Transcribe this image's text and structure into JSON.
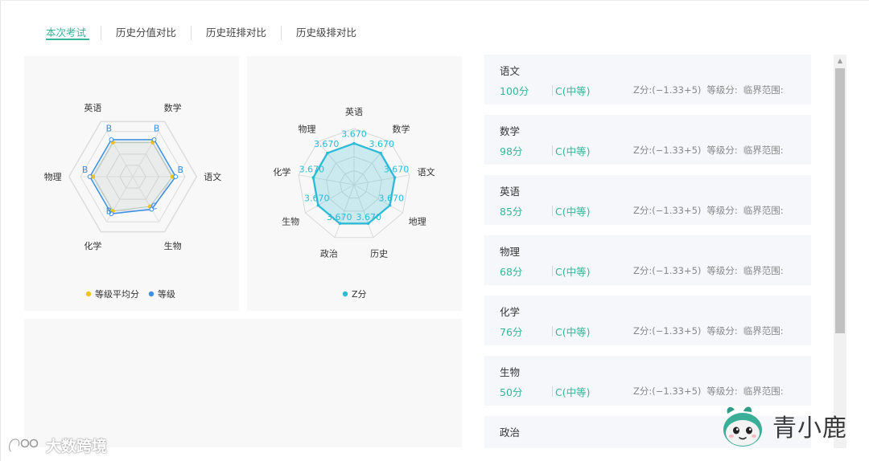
{
  "tabs": [
    {
      "label": "本次考试",
      "active": true
    },
    {
      "label": "历史分值对比",
      "active": false
    },
    {
      "label": "历史班排对比",
      "active": false
    },
    {
      "label": "历史级排对比",
      "active": false
    }
  ],
  "colors": {
    "accent": "#36b59b",
    "grade_series": "#3f8fe0",
    "avg_series": "#f5c11d",
    "z_series": "#29bcd8"
  },
  "chart_data": [
    {
      "type": "radar",
      "axes": [
        "数学",
        "语文",
        "生物",
        "化学",
        "物理",
        "英语"
      ],
      "series": [
        {
          "name": "等级平均分",
          "values": [
            "B",
            "B",
            "C",
            "B",
            "B",
            "B"
          ]
        },
        {
          "name": "等级",
          "values": [
            "B",
            "B",
            "C",
            "B",
            "B",
            "B"
          ]
        }
      ],
      "point_labels": [
        "B",
        "B",
        "C",
        "B",
        "B",
        "B"
      ],
      "legend": [
        "等级平均分",
        "等级"
      ],
      "legend_position": "bottom"
    },
    {
      "type": "radar",
      "axes": [
        "英语",
        "数学",
        "语文",
        "地理",
        "历史",
        "政治",
        "生物",
        "化学",
        "物理"
      ],
      "series": [
        {
          "name": "Z分",
          "values": [
            3.67,
            3.67,
            3.67,
            3.67,
            3.67,
            3.67,
            3.67,
            3.67,
            3.67
          ]
        }
      ],
      "point_labels": [
        "3.670",
        "3.670",
        "3.670",
        "3.670",
        "3.670",
        "3.670",
        "3.670",
        "3.670",
        "3.670"
      ],
      "legend": [
        "Z分"
      ],
      "legend_position": "bottom"
    }
  ],
  "subjects": [
    {
      "name": "语文",
      "score": "100分",
      "level": "C(中等)",
      "z": "Z分:(−1.33+5)",
      "grade_score": "等级分:",
      "range": "临界范围:"
    },
    {
      "name": "数学",
      "score": "98分",
      "level": "C(中等)",
      "z": "Z分:(−1.33+5)",
      "grade_score": "等级分:",
      "range": "临界范围:"
    },
    {
      "name": "英语",
      "score": "85分",
      "level": "C(中等)",
      "z": "Z分:(−1.33+5)",
      "grade_score": "等级分:",
      "range": "临界范围:"
    },
    {
      "name": "物理",
      "score": "68分",
      "level": "C(中等)",
      "z": "Z分:(−1.33+5)",
      "grade_score": "等级分:",
      "range": "临界范围:"
    },
    {
      "name": "化学",
      "score": "76分",
      "level": "C(中等)",
      "z": "Z分:(−1.33+5)",
      "grade_score": "等级分:",
      "range": "临界范围:"
    },
    {
      "name": "生物",
      "score": "50分",
      "level": "C(中等)",
      "z": "Z分:(−1.33+5)",
      "grade_score": "等级分:",
      "range": "临界范围:"
    },
    {
      "name": "政治",
      "score": "",
      "level": "",
      "z": "",
      "grade_score": "",
      "range": ""
    }
  ],
  "watermark_left": "大数跨境",
  "watermark_right": "青小鹿"
}
